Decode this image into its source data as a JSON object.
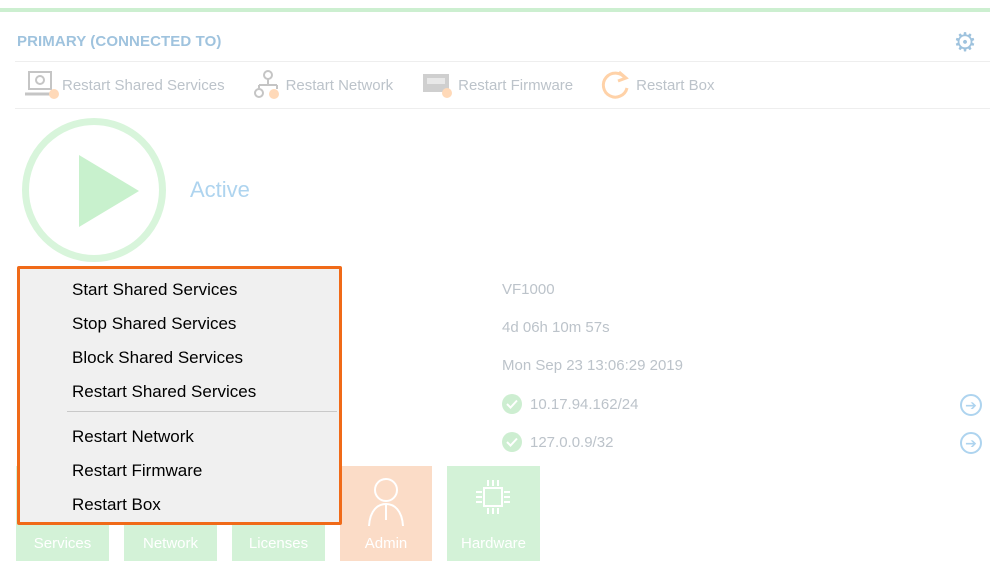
{
  "panel": {
    "title": "PRIMARY (CONNECTED TO)",
    "settings_icon": "gear-icon"
  },
  "toolbar": {
    "items": [
      {
        "label": "Restart Shared Services",
        "icon": "shared-services-restart-icon"
      },
      {
        "label": "Restart Network",
        "icon": "network-restart-icon"
      },
      {
        "label": "Restart Firmware",
        "icon": "firmware-restart-icon"
      },
      {
        "label": "Restart Box",
        "icon": "box-restart-icon"
      }
    ]
  },
  "status": {
    "label": "Active",
    "icon": "play-icon",
    "color": "#7ee08a"
  },
  "info": {
    "model": "VF1000",
    "uptime": "4d 06h 10m 57s",
    "datetime": "Mon Sep 23 13:06:29 2019",
    "ips": [
      {
        "address": "10.17.94.162/24",
        "status": "ok"
      },
      {
        "address": "127.0.0.9/32",
        "status": "ok"
      }
    ]
  },
  "tiles": [
    {
      "label": "Services",
      "color": "green"
    },
    {
      "label": "Network",
      "color": "green"
    },
    {
      "label": "Licenses",
      "color": "green"
    },
    {
      "label": "Admin",
      "color": "orange",
      "icon": "user-icon"
    },
    {
      "label": "Hardware",
      "color": "green",
      "icon": "chip-icon"
    }
  ],
  "context_menu": {
    "items": [
      "Start Shared Services",
      "Stop Shared Services",
      "Block Shared Services",
      "Restart Shared Services",
      "Restart Network",
      "Restart Firmware",
      "Restart Box"
    ],
    "highlight_color": "#f06a18"
  }
}
